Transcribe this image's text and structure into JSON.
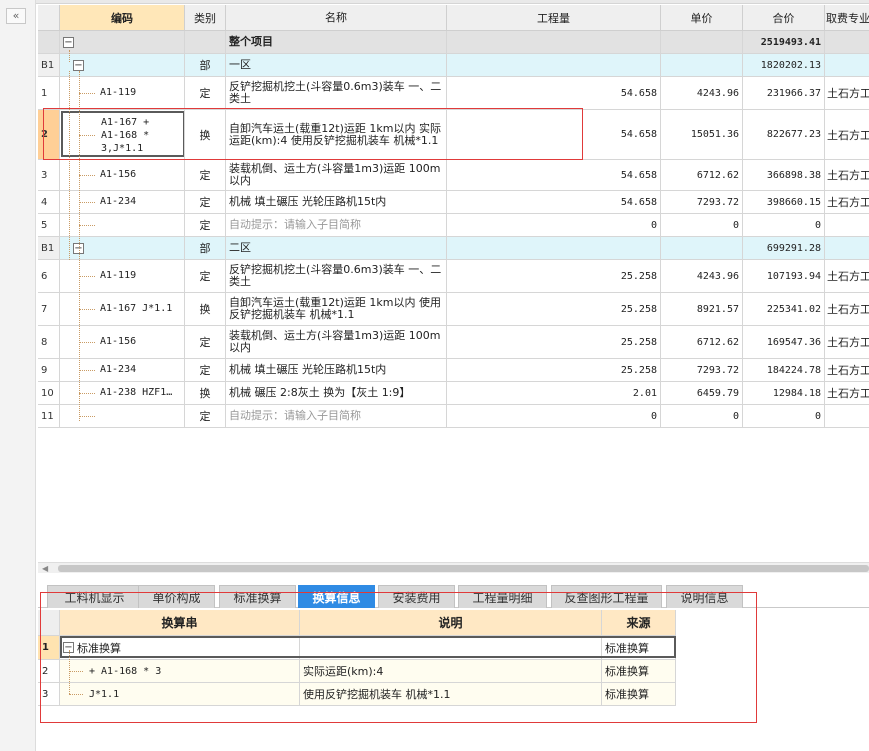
{
  "rail": {
    "collapse_label": "«"
  },
  "grid": {
    "columns": {
      "code": "编码",
      "type": "类别",
      "name": "名称",
      "qty": "工程量",
      "price": "单价",
      "total": "合价",
      "fee": "取费专业"
    },
    "total_row": {
      "name": "整个项目",
      "total": "2519493.41"
    },
    "section1": {
      "idx": "B1",
      "type": "部",
      "name": "一区",
      "total": "1820202.13"
    },
    "rows1": [
      {
        "idx": "1",
        "code": "A1-119",
        "type": "定",
        "name": "反铲挖掘机挖土(斗容量0.6m3)装车 一、二类土",
        "qty": "54.658",
        "price": "4243.96",
        "total": "231966.37",
        "fee": "土石方工程"
      },
      {
        "idx": "2",
        "code_lines": [
          "A1-167 +",
          "A1-168 *",
          "3,J*1.1"
        ],
        "type": "换",
        "name": "自卸汽车运土(载重12t)运距 1km以内 实际运距(km):4  使用反铲挖掘机装车 机械*1.1",
        "qty": "54.658",
        "price": "15051.36",
        "total": "822677.23",
        "fee": "土石方工程"
      },
      {
        "idx": "3",
        "code": "A1-156",
        "type": "定",
        "name": "装载机倒、运土方(斗容量1m3)运距 100m以内",
        "qty": "54.658",
        "price": "6712.62",
        "total": "366898.38",
        "fee": "土石方工程"
      },
      {
        "idx": "4",
        "code": "A1-234",
        "type": "定",
        "name": "机械 填土碾压 光轮压路机15t内",
        "qty": "54.658",
        "price": "7293.72",
        "total": "398660.15",
        "fee": "土石方工程"
      },
      {
        "idx": "5",
        "code": "",
        "type": "定",
        "name": "自动提示：请输入子目简称",
        "qty": "0",
        "price": "0",
        "total": "0",
        "fee": ""
      }
    ],
    "section2": {
      "idx": "B1",
      "type": "部",
      "name": "二区",
      "total": "699291.28"
    },
    "rows2": [
      {
        "idx": "6",
        "code": "A1-119",
        "type": "定",
        "name": "反铲挖掘机挖土(斗容量0.6m3)装车 一、二类土",
        "qty": "25.258",
        "price": "4243.96",
        "total": "107193.94",
        "fee": "土石方工程"
      },
      {
        "idx": "7",
        "code": "A1-167 J*1.1",
        "type": "换",
        "name": "自卸汽车运土(载重12t)运距 1km以内 使用反铲挖掘机装车 机械*1.1",
        "qty": "25.258",
        "price": "8921.57",
        "total": "225341.02",
        "fee": "土石方工程"
      },
      {
        "idx": "8",
        "code": "A1-156",
        "type": "定",
        "name": "装载机倒、运土方(斗容量1m3)运距 100m以内",
        "qty": "25.258",
        "price": "6712.62",
        "total": "169547.36",
        "fee": "土石方工程"
      },
      {
        "idx": "9",
        "code": "A1-234",
        "type": "定",
        "name": "机械 填土碾压 光轮压路机15t内",
        "qty": "25.258",
        "price": "7293.72",
        "total": "184224.78",
        "fee": "土石方工程"
      },
      {
        "idx": "10",
        "code": "A1-238 HZF1…",
        "type": "换",
        "name": "机械 碾压 2:8灰土  换为【灰土 1:9】",
        "qty": "2.01",
        "price": "6459.79",
        "total": "12984.18",
        "fee": "土石方工程"
      },
      {
        "idx": "11",
        "code": "",
        "type": "定",
        "name": "自动提示：请输入子目简称",
        "qty": "0",
        "price": "0",
        "total": "0",
        "fee": ""
      }
    ]
  },
  "tabs": [
    "工料机显示",
    "单价构成",
    "标准换算",
    "换算信息",
    "安装费用",
    "工程量明细",
    "反查图形工程量",
    "说明信息"
  ],
  "active_tab": "换算信息",
  "subgrid": {
    "columns": {
      "str": "换算串",
      "desc": "说明",
      "src": "来源"
    },
    "rows": [
      {
        "idx": "1",
        "str": "标准换算",
        "desc": "",
        "src": "标准换算"
      },
      {
        "idx": "2",
        "str": "+ A1-168 * 3",
        "desc": "实际运距(km):4",
        "src": "标准换算"
      },
      {
        "idx": "3",
        "str": "J*1.1",
        "desc": "使用反铲挖掘机装车 机械*1.1",
        "src": "标准换算"
      }
    ]
  }
}
